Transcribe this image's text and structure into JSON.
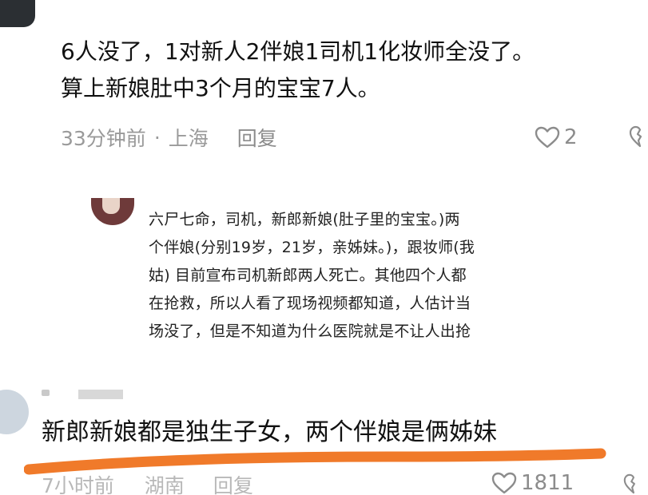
{
  "comment_top": {
    "text_line1": "6人没了，1对新人2伴娘1司机1化妆师全没了。",
    "text_line2": "算上新娘肚中3个月的宝宝7人。",
    "time": "33分钟前",
    "separator": "·",
    "location": "上海",
    "reply_label": "回复",
    "like_count": "2",
    "icons": {
      "like": "heart-icon",
      "dislike": "broken-heart-icon"
    }
  },
  "quoted_reply": {
    "lines": [
      "六尸七命，司机，新郎新娘(肚子里的宝宝。)两",
      "个伴娘(分别19岁，21岁，亲姊妹。)，跟妆师(我",
      "姑) 目前宣布司机新郎两人死亡。其他四个人都",
      "在抢救，所以人看了现场视频都知道，人估计当",
      "场没了，但是不知道为什么医院就是不让人出抢"
    ]
  },
  "comment_bottom": {
    "text": "新郎新娘都是独生子女，两个伴娘是俩姊妹",
    "time": "7小时前",
    "location": "湖南",
    "reply_label": "回复",
    "like_count": "1811",
    "highlight_color": "#f07a2a",
    "icons": {
      "like": "heart-icon",
      "dislike": "broken-heart-icon"
    }
  }
}
